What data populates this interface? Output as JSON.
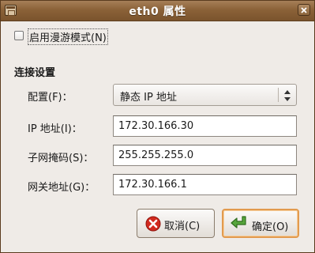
{
  "titlebar": {
    "title": "eth0 属性"
  },
  "roaming": {
    "label": "启用漫游模式(N)",
    "checked": false
  },
  "section": {
    "heading": "连接设置"
  },
  "config": {
    "label": "配置(F)：",
    "value": "静态 IP 地址"
  },
  "ip": {
    "label": "IP 地址(I)：",
    "value": "172.30.166.30"
  },
  "netmask": {
    "label": "子网掩码(S)：",
    "value": "255.255.255.0"
  },
  "gateway": {
    "label": "网关地址(G)：",
    "value": "172.30.166.1"
  },
  "buttons": {
    "cancel_label": "取消(C)",
    "ok_label": "确定(O)"
  },
  "icons": {
    "window": "network-settings-icon",
    "close": "close-icon",
    "cancel": "cancel-icon",
    "ok": "ok-arrow-icon"
  },
  "colors": {
    "titlebar": "#8b6238",
    "focus_ring": "#e29a4e",
    "cancel_icon": "#d12a1f",
    "ok_icon": "#57a63c"
  }
}
